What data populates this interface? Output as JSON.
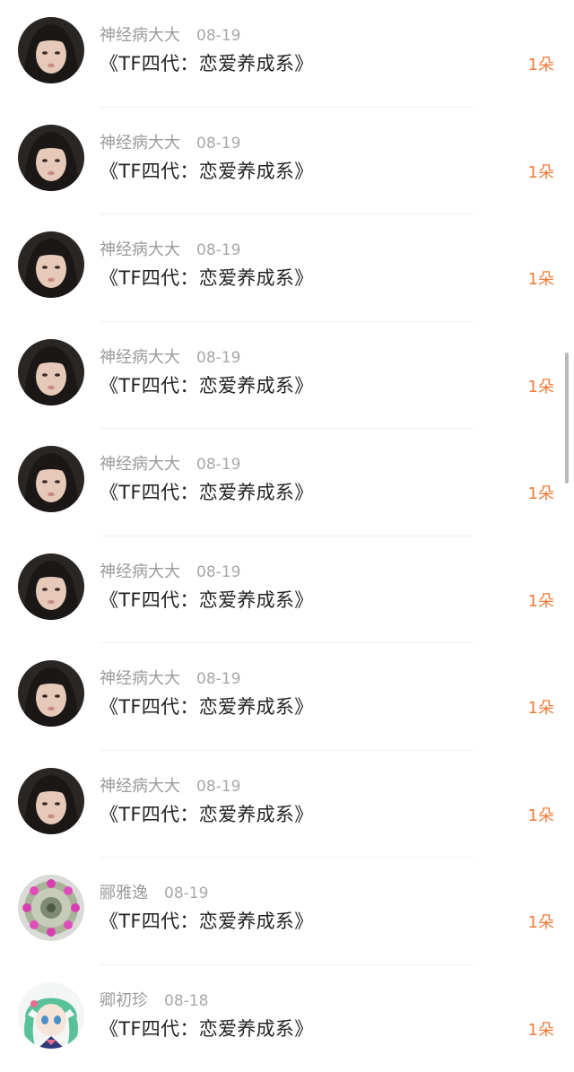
{
  "gift_unit_color": "#f07a37",
  "entries": [
    {
      "username": "神经病大大",
      "date": "08-19",
      "title": "《TF四代：恋爱养成系》",
      "flowers": "1朵",
      "avatar_icon": "girl-portrait-avatar"
    },
    {
      "username": "神经病大大",
      "date": "08-19",
      "title": "《TF四代：恋爱养成系》",
      "flowers": "1朵",
      "avatar_icon": "girl-portrait-avatar"
    },
    {
      "username": "神经病大大",
      "date": "08-19",
      "title": "《TF四代：恋爱养成系》",
      "flowers": "1朵",
      "avatar_icon": "girl-portrait-avatar"
    },
    {
      "username": "神经病大大",
      "date": "08-19",
      "title": "《TF四代：恋爱养成系》",
      "flowers": "1朵",
      "avatar_icon": "girl-portrait-avatar"
    },
    {
      "username": "神经病大大",
      "date": "08-19",
      "title": "《TF四代：恋爱养成系》",
      "flowers": "1朵",
      "avatar_icon": "girl-portrait-avatar"
    },
    {
      "username": "神经病大大",
      "date": "08-19",
      "title": "《TF四代：恋爱养成系》",
      "flowers": "1朵",
      "avatar_icon": "girl-portrait-avatar"
    },
    {
      "username": "神经病大大",
      "date": "08-19",
      "title": "《TF四代：恋爱养成系》",
      "flowers": "1朵",
      "avatar_icon": "girl-portrait-avatar"
    },
    {
      "username": "神经病大大",
      "date": "08-19",
      "title": "《TF四代：恋爱养成系》",
      "flowers": "1朵",
      "avatar_icon": "girl-portrait-avatar"
    },
    {
      "username": "郦雅逸",
      "date": "08-19",
      "title": "《TF四代：恋爱养成系》",
      "flowers": "1朵",
      "avatar_icon": "flower-cactus-avatar"
    },
    {
      "username": "卿初珍",
      "date": "08-18",
      "title": "《TF四代：恋爱养成系》",
      "flowers": "1朵",
      "avatar_icon": "anime-girl-avatar"
    }
  ]
}
